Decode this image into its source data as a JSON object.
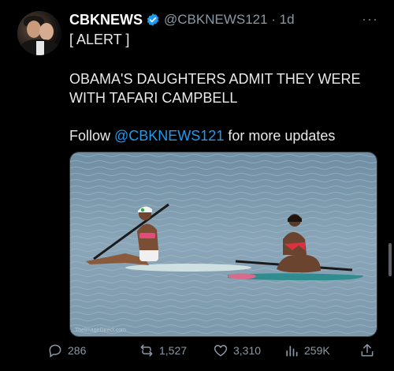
{
  "tweet": {
    "display_name": "CBKNEWS",
    "handle_time": "@CBKNEWS121 · 1d",
    "more_icon": "more-dots-icon",
    "lines": {
      "alert": "[ ALERT ]",
      "headline_1": "OBAMA'S DAUGHTERS ADMIT THEY WERE",
      "headline_2": "WITH TAFARI CAMPBELL",
      "follow_prefix": "Follow ",
      "follow_mention": "@CBKNEWS121",
      "follow_suffix": " for more updates"
    },
    "media": {
      "watermark": "TheImageDirect.com"
    },
    "actions": {
      "replies": "286",
      "reposts": "1,527",
      "likes": "3,310",
      "views": "259K"
    }
  },
  "colors": {
    "background": "#000000",
    "text": "#e7e9ea",
    "secondary": "#8b98a5",
    "accent": "#1d9bf0"
  }
}
